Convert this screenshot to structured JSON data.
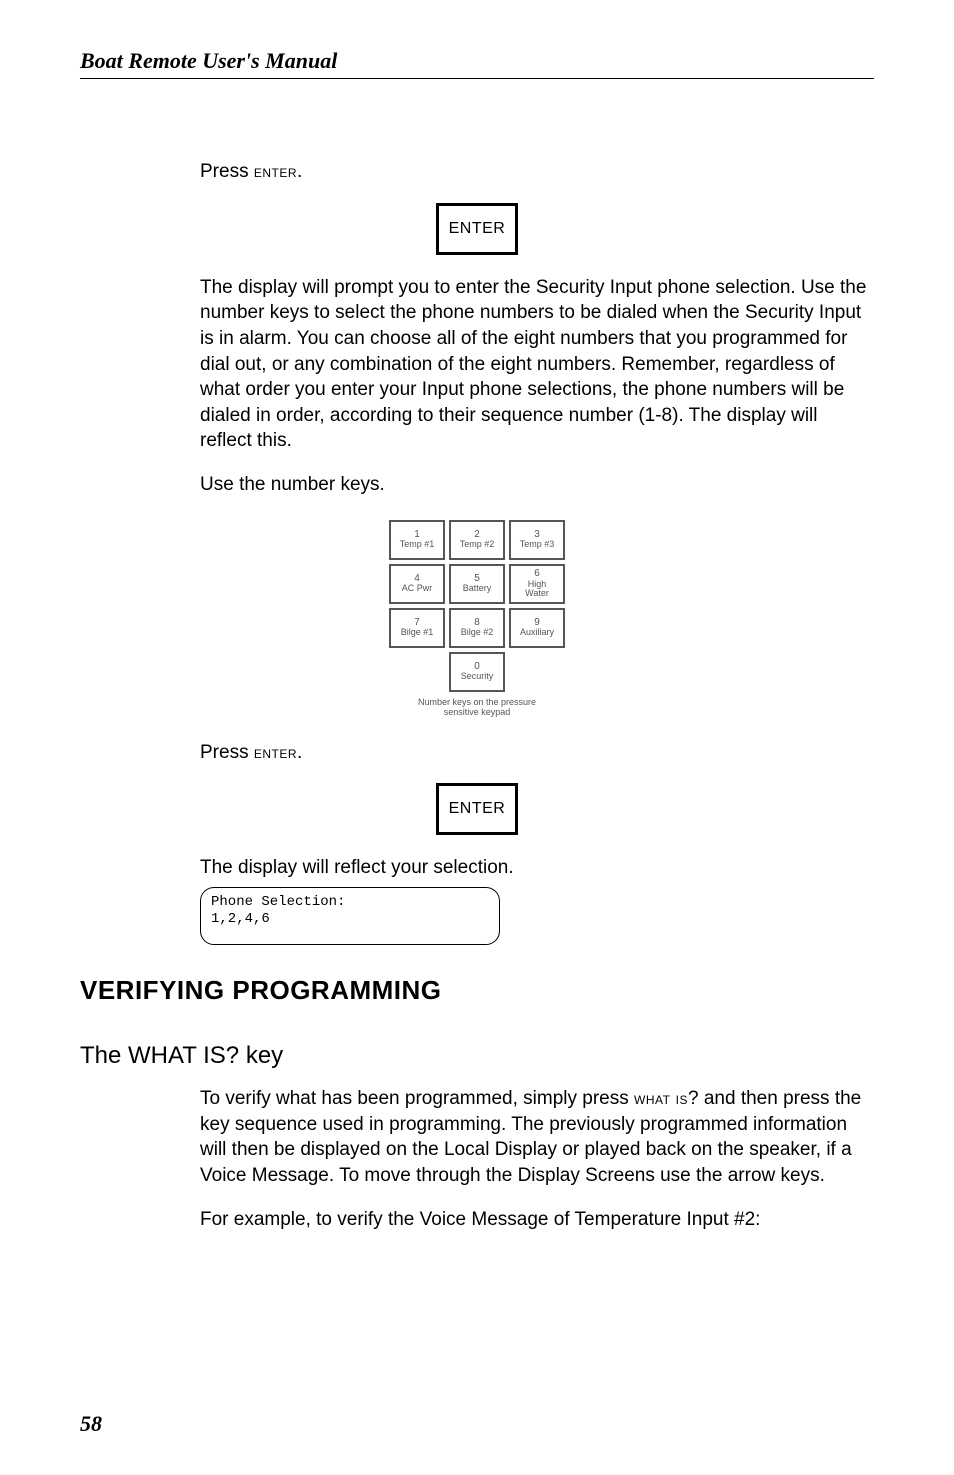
{
  "runningHead": "Boat Remote User's Manual",
  "p1_prefix": "Press ",
  "p1_sc": "enter",
  "p1_suffix": ".",
  "enterLabel": "ENTER",
  "p2": "The display will prompt you to enter the Security Input phone selection. Use the number keys to select the phone numbers to be dialed when the Security Input is in alarm. You can choose all of the eight numbers that you programmed for dial out, or any combination of the eight numbers. Remember, regardless of what order you enter your Input phone selections, the phone numbers will be dialed in order, according to their sequence number (1-8). The display will reflect this.",
  "p3": "Use the number keys.",
  "keypad": {
    "rows": [
      [
        {
          "num": "1",
          "label": "Temp #1"
        },
        {
          "num": "2",
          "label": "Temp #2"
        },
        {
          "num": "3",
          "label": "Temp #3"
        }
      ],
      [
        {
          "num": "4",
          "label": "AC Pwr"
        },
        {
          "num": "5",
          "label": "Battery"
        },
        {
          "num": "6",
          "label": "High\nWater"
        }
      ],
      [
        {
          "num": "7",
          "label": "Bilge #1"
        },
        {
          "num": "8",
          "label": "Bilge #2"
        },
        {
          "num": "9",
          "label": "Auxiliary"
        }
      ],
      [
        null,
        {
          "num": "0",
          "label": "Security"
        },
        null
      ]
    ],
    "captionLine1": "Number keys on the pressure",
    "captionLine2": "sensitive keypad"
  },
  "p4_prefix": "Press ",
  "p4_sc": "enter",
  "p4_suffix": ".",
  "p5": "The display will reflect your selection.",
  "lcd": {
    "line1": "Phone Selection:",
    "line2": "1,2,4,6"
  },
  "h1": "VERIFYING PROGRAMMING",
  "h2": "The WHAT IS? key",
  "p6_a": "To verify what has been programmed, simply press ",
  "p6_sc": "what is",
  "p6_b": "? and then press the key sequence used in programming. The previously programmed information will then be displayed on the Local Display or played back on the speaker, if a Voice Message. To move through the Display Screens use the arrow keys.",
  "p7": "For example, to verify the Voice Message of Temperature Input #2:",
  "pageNumber": "58"
}
